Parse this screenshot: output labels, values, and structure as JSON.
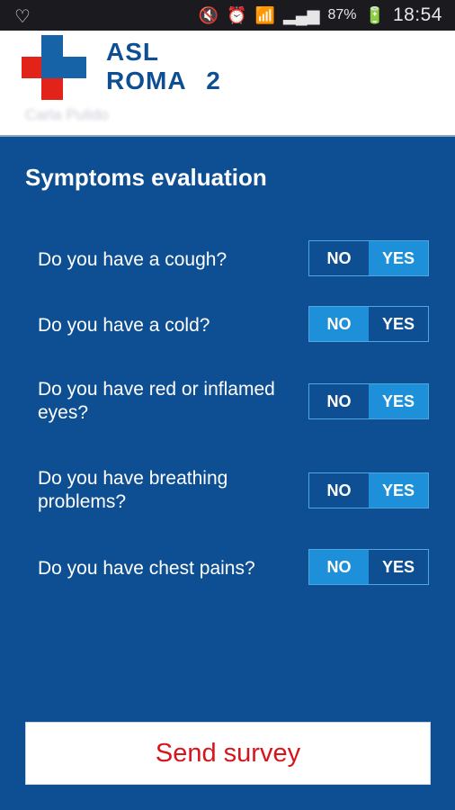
{
  "statusbar": {
    "heart_icon": "heart-outline-icon",
    "battery_pct": "87%",
    "time": "18:54"
  },
  "header": {
    "brand_line1": "ASL",
    "brand_line2": "ROMA 2",
    "subtitle": "Carla Pulido",
    "colors": {
      "brand": "#0e4f93",
      "cross_blue": "#1763a8",
      "cross_red": "#e2231a"
    }
  },
  "main": {
    "title": "Symptoms evaluation",
    "questions": [
      {
        "text": "Do you have a cough?",
        "no": "NO",
        "yes": "YES",
        "selected": "YES"
      },
      {
        "text": "Do you have a cold?",
        "no": "NO",
        "yes": "YES",
        "selected": "NO"
      },
      {
        "text": "Do you have red or inflamed eyes?",
        "no": "NO",
        "yes": "YES",
        "selected": "YES"
      },
      {
        "text": "Do you have breathing problems?",
        "no": "NO",
        "yes": "YES",
        "selected": "YES"
      },
      {
        "text": "Do you have chest pains?",
        "no": "NO",
        "yes": "YES",
        "selected": "NO"
      }
    ],
    "send_label": "Send survey",
    "colors": {
      "background": "#0e4f93",
      "toggle_active": "#1e90d9",
      "send_text": "#d6151c"
    }
  }
}
